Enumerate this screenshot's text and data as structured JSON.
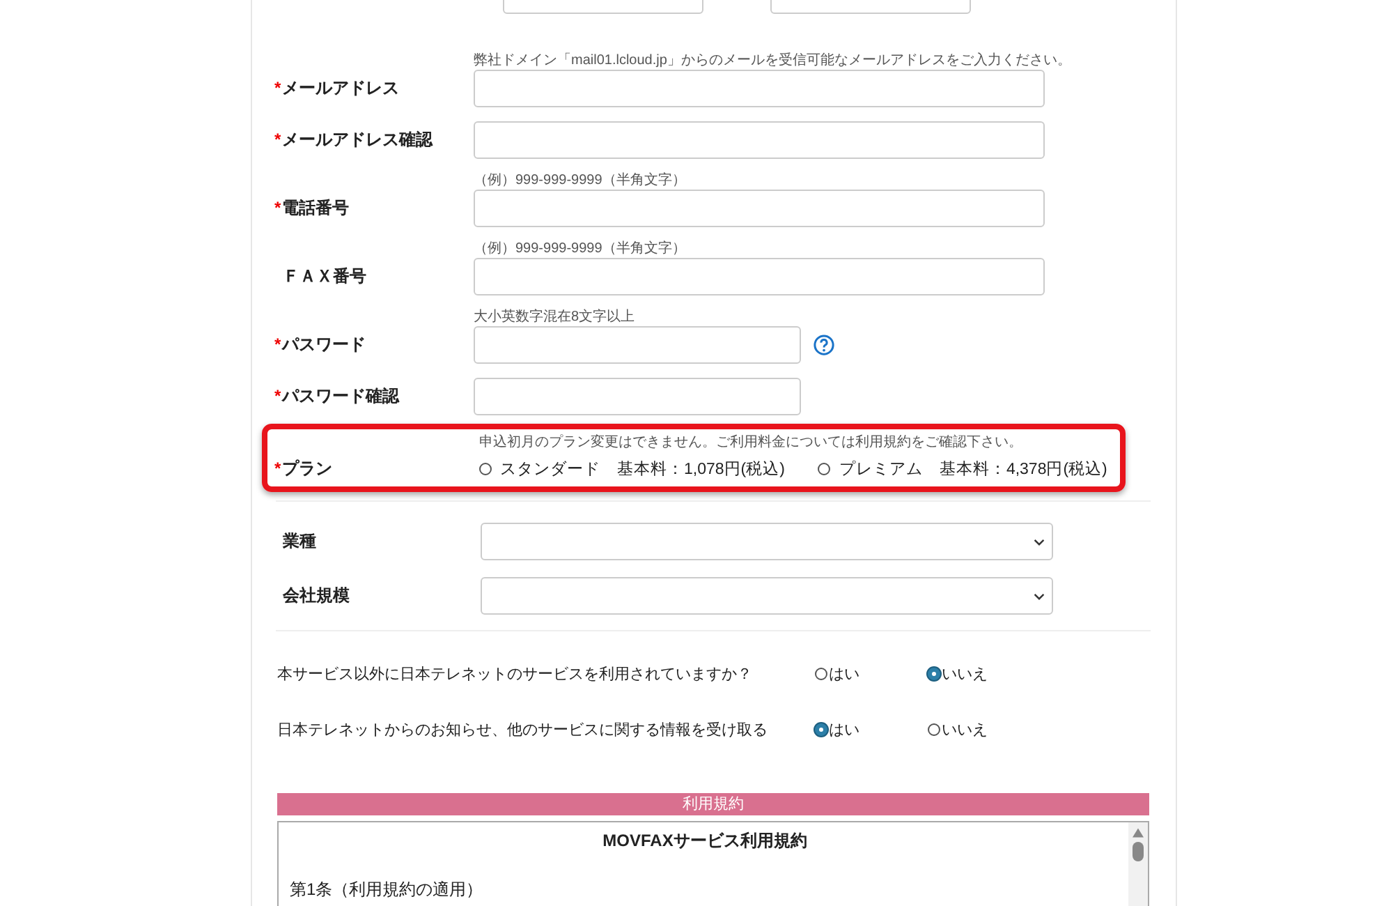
{
  "fields": [
    {
      "mark": "*",
      "label": "メールアドレス",
      "hint": "弊社ドメイン「mail01.lcloud.jp」からのメールを受信可能なメールアドレスをご入力ください。",
      "kind": "text"
    },
    {
      "mark": "*",
      "label": "メールアドレス確認",
      "kind": "text"
    },
    {
      "mark": "*",
      "label": "電話番号",
      "hint": "（例）999-999-9999（半角文字）",
      "kind": "text"
    },
    {
      "label": "ＦＡＸ番号",
      "hint": "（例）999-999-9999（半角文字）",
      "kind": "text"
    },
    {
      "mark": "*",
      "label": "パスワード",
      "hint": "大小英数字混在8文字以上",
      "kind": "password",
      "help": true
    },
    {
      "mark": "*",
      "label": "パスワード確認",
      "kind": "password"
    }
  ],
  "plan": {
    "mark": "*",
    "label": "プラン",
    "highlighted": true,
    "hint": "申込初月のプラン変更はできません。ご利用料金については利用規約をご確認下さい。",
    "options": [
      {
        "label": "スタンダード",
        "price": "基本料：1,078円(税込)",
        "selected": false
      },
      {
        "label": "プレミアム",
        "price": "基本料：4,378円(税込)",
        "selected": false
      }
    ]
  },
  "selects": [
    {
      "label": "業種"
    },
    {
      "label": "会社規模"
    }
  ],
  "questions": [
    {
      "text": "本サービス以外に日本テレネットのサービスを利用されていますか？",
      "options": [
        {
          "label": "はい",
          "selected": false
        },
        {
          "label": "いいえ",
          "selected": true
        }
      ]
    },
    {
      "text": "日本テレネットからのお知らせ、他のサービスに関する情報を受け取る",
      "options": [
        {
          "label": "はい",
          "selected": true
        },
        {
          "label": "いいえ",
          "selected": false
        }
      ]
    }
  ],
  "terms": {
    "header": "利用規約",
    "title": "MOVFAXサービス利用規約",
    "lines": [
      "第1条（利用規約の適用）"
    ]
  }
}
